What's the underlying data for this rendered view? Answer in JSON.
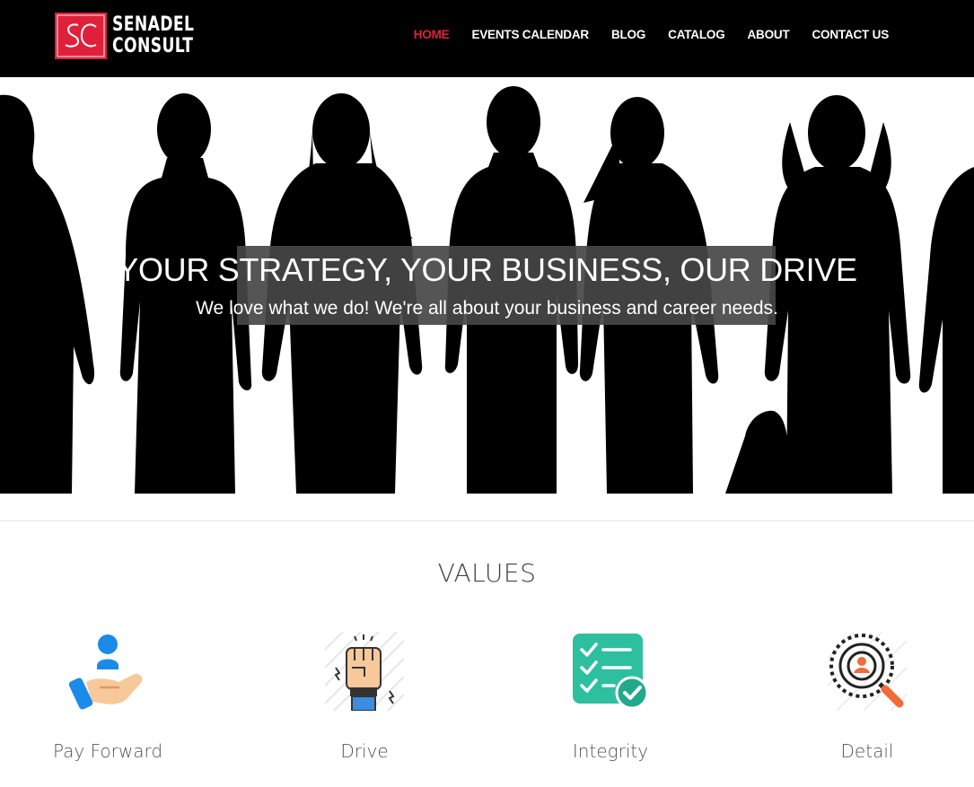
{
  "header": {
    "logo_mark": "SC",
    "logo_line1": "SENADEL",
    "logo_line2": "CONSULT",
    "nav": [
      {
        "label": "HOME",
        "active": true
      },
      {
        "label": "EVENTS CALENDAR"
      },
      {
        "label": "BLOG"
      },
      {
        "label": "CATALOG"
      },
      {
        "label": "ABOUT"
      },
      {
        "label": "CONTACT US"
      }
    ],
    "accent_color": "#e0203a"
  },
  "hero": {
    "title": "YOUR STRATEGY, YOUR BUSINESS, OUR DRIVE",
    "subtitle": "We love what we do! We're all about your business and career needs."
  },
  "values": {
    "title": "VALUES",
    "items": [
      {
        "label": "Pay Forward",
        "icon": "hand-giving-icon"
      },
      {
        "label": "Drive",
        "icon": "raised-fist-icon"
      },
      {
        "label": "Integrity",
        "icon": "checklist-icon"
      },
      {
        "label": "Detail",
        "icon": "magnifier-search-icon"
      }
    ]
  }
}
